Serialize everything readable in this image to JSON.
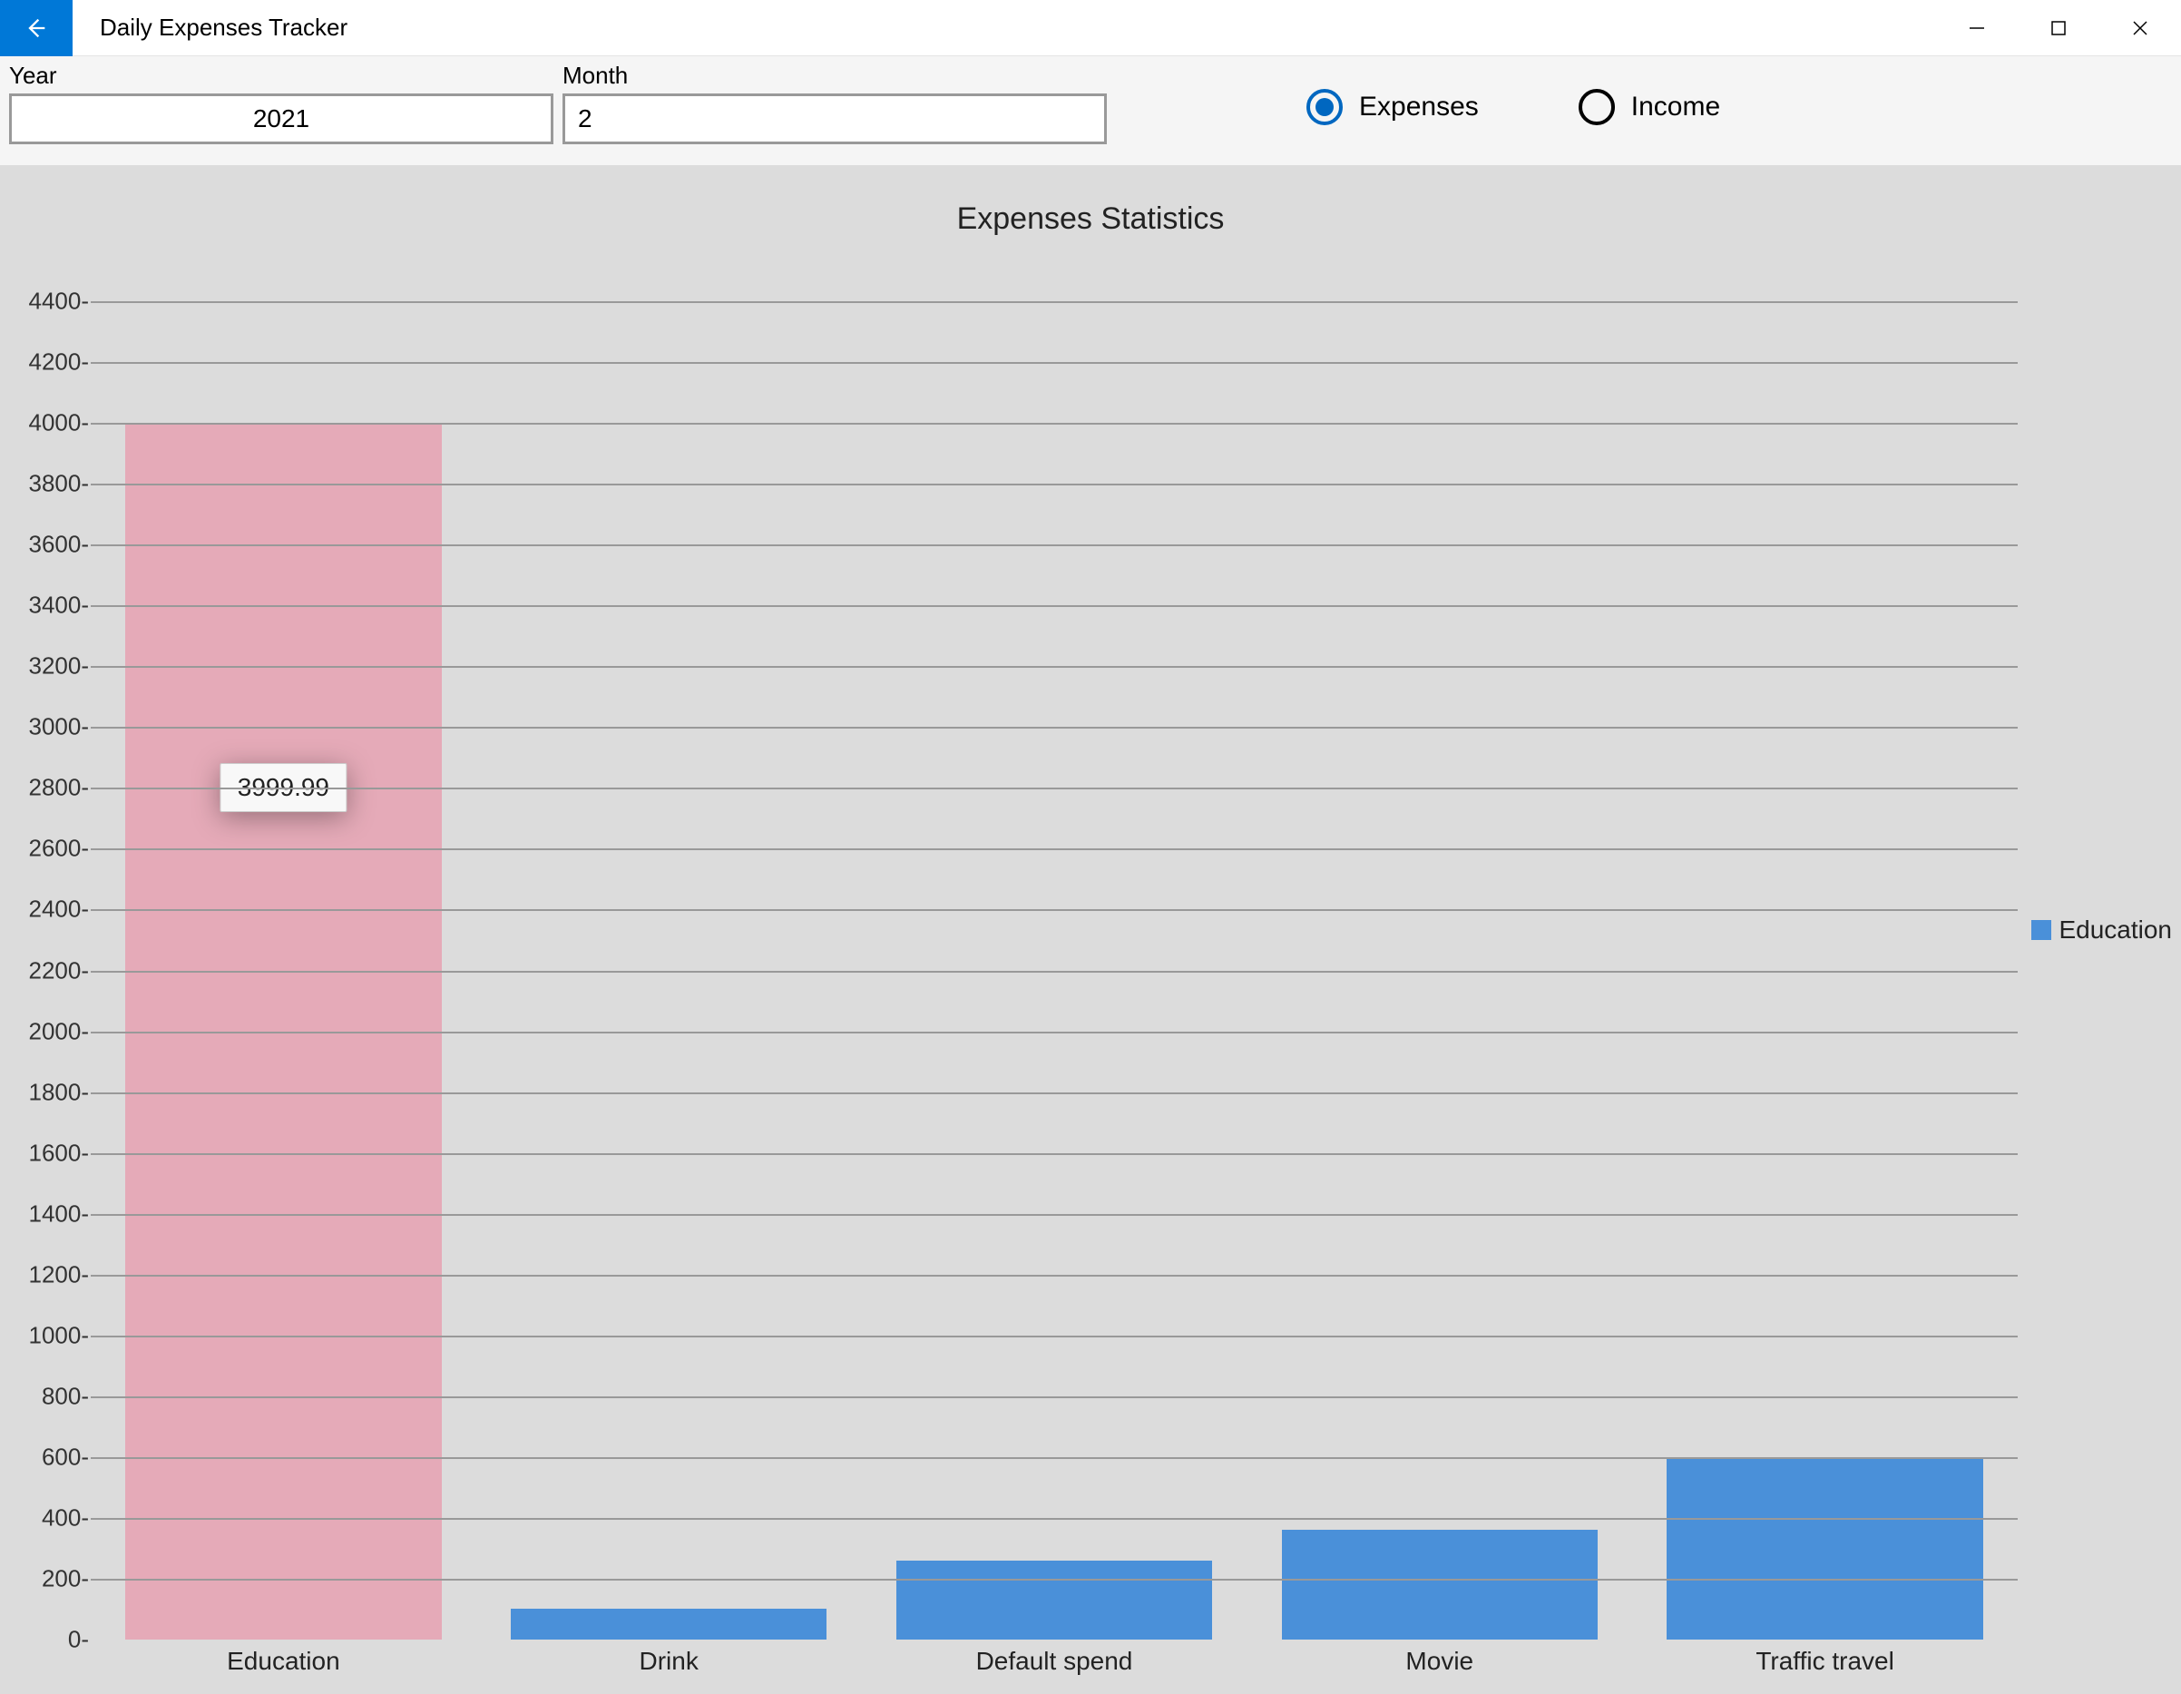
{
  "window": {
    "title": "Daily Expenses Tracker"
  },
  "filters": {
    "year_label": "Year",
    "year_value": "2021",
    "month_label": "Month",
    "month_value": "2"
  },
  "radios": {
    "expenses_label": "Expenses",
    "income_label": "Income",
    "selected": "expenses"
  },
  "chart_data": {
    "type": "bar",
    "title": "Expenses Statistics",
    "categories": [
      "Education",
      "Drink",
      "Default spend",
      "Movie",
      "Traffic travel"
    ],
    "values": [
      3999.99,
      100,
      260,
      360,
      600
    ],
    "ylim": [
      0,
      4400
    ],
    "y_ticks": [
      0,
      200,
      400,
      600,
      800,
      1000,
      1200,
      1400,
      1600,
      1800,
      2000,
      2200,
      2400,
      2600,
      2800,
      3000,
      3200,
      3400,
      3600,
      3800,
      4000,
      4200,
      4400
    ],
    "first_gridline_at": 200,
    "highlight_index": 0,
    "tooltip_value": "3999.99",
    "legend": "Education",
    "xlabel": "",
    "ylabel": ""
  }
}
